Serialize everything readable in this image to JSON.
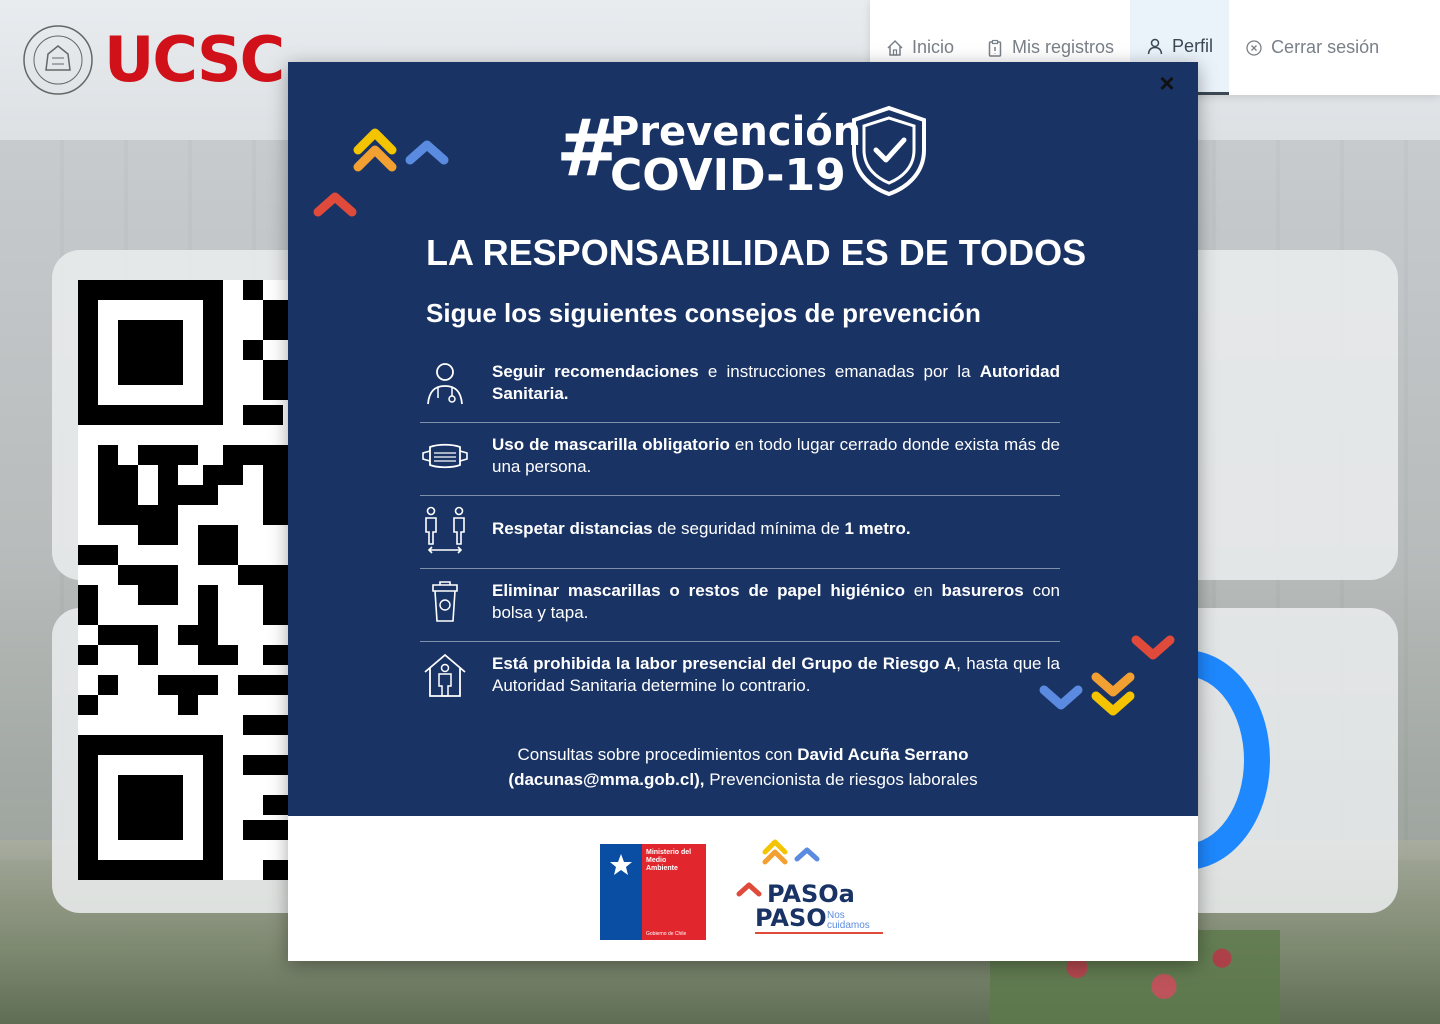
{
  "brand": {
    "name": "UCSC",
    "seal_icon": "university-seal-icon"
  },
  "nav": {
    "items": [
      {
        "label": "Inicio",
        "icon": "home-icon"
      },
      {
        "label": "Mis registros",
        "icon": "clipboard-icon"
      },
      {
        "label": "Perfil",
        "icon": "user-icon",
        "active": true
      },
      {
        "label": "Cerrar sesión",
        "icon": "close-circle-icon"
      }
    ]
  },
  "modal": {
    "hashtag": "#",
    "title_line1": "Prevención",
    "title_line2": "COVID-19",
    "headline": "LA RESPONSABILIDAD ES DE TODOS",
    "subheadline": "Sigue los siguientes consejos de prevención",
    "tips": [
      {
        "icon": "doctor-icon",
        "bold1": "Seguir recomendaciones",
        "text1": " e instrucciones emanadas por la ",
        "bold2": "Autoridad Sanitaria.",
        "text2": ""
      },
      {
        "icon": "mask-icon",
        "bold1": "Uso de mascarilla obligatorio",
        "text1": " en todo lugar cerrado donde exista más de una persona.",
        "bold2": "",
        "text2": ""
      },
      {
        "icon": "distance-icon",
        "bold1": "Respetar distancias",
        "text1": " de seguridad mínima de ",
        "bold2": "1 metro.",
        "text2": ""
      },
      {
        "icon": "trash-bin-icon",
        "bold1": "Eliminar mascarillas o restos de papel higiénico",
        "text1": " en ",
        "bold2": "basureros",
        "text2": " con bolsa y tapa."
      },
      {
        "icon": "stay-home-icon",
        "bold1": "Está prohibida la labor presencial del Grupo de Riesgo A",
        "text1": ", hasta que la Autoridad Sanitaria determine lo contrario.",
        "bold2": "",
        "text2": ""
      }
    ],
    "contact": {
      "text1": "Consultas sobre procedimientos con ",
      "name": "David Acuña Serrano",
      "email": "(dacunas@mma.gob.cl),",
      "text2": " Prevencionista de riesgos laborales"
    },
    "footer": {
      "ministry_label": "Ministerio del Medio Ambiente",
      "gov_label": "Gobierno de Chile",
      "paso_line1": "PASOa",
      "paso_line2": "PASO",
      "paso_tagline": "Nos cuidamos"
    },
    "close_label": "×"
  },
  "colors": {
    "brand_red": "#d0111a",
    "modal_navy": "#193365",
    "accent_blue": "#1e88ff",
    "chevron_yellow": "#f5c400",
    "chevron_orange": "#f3a032",
    "chevron_red": "#e04a3b",
    "chevron_blue": "#5b8be0"
  }
}
